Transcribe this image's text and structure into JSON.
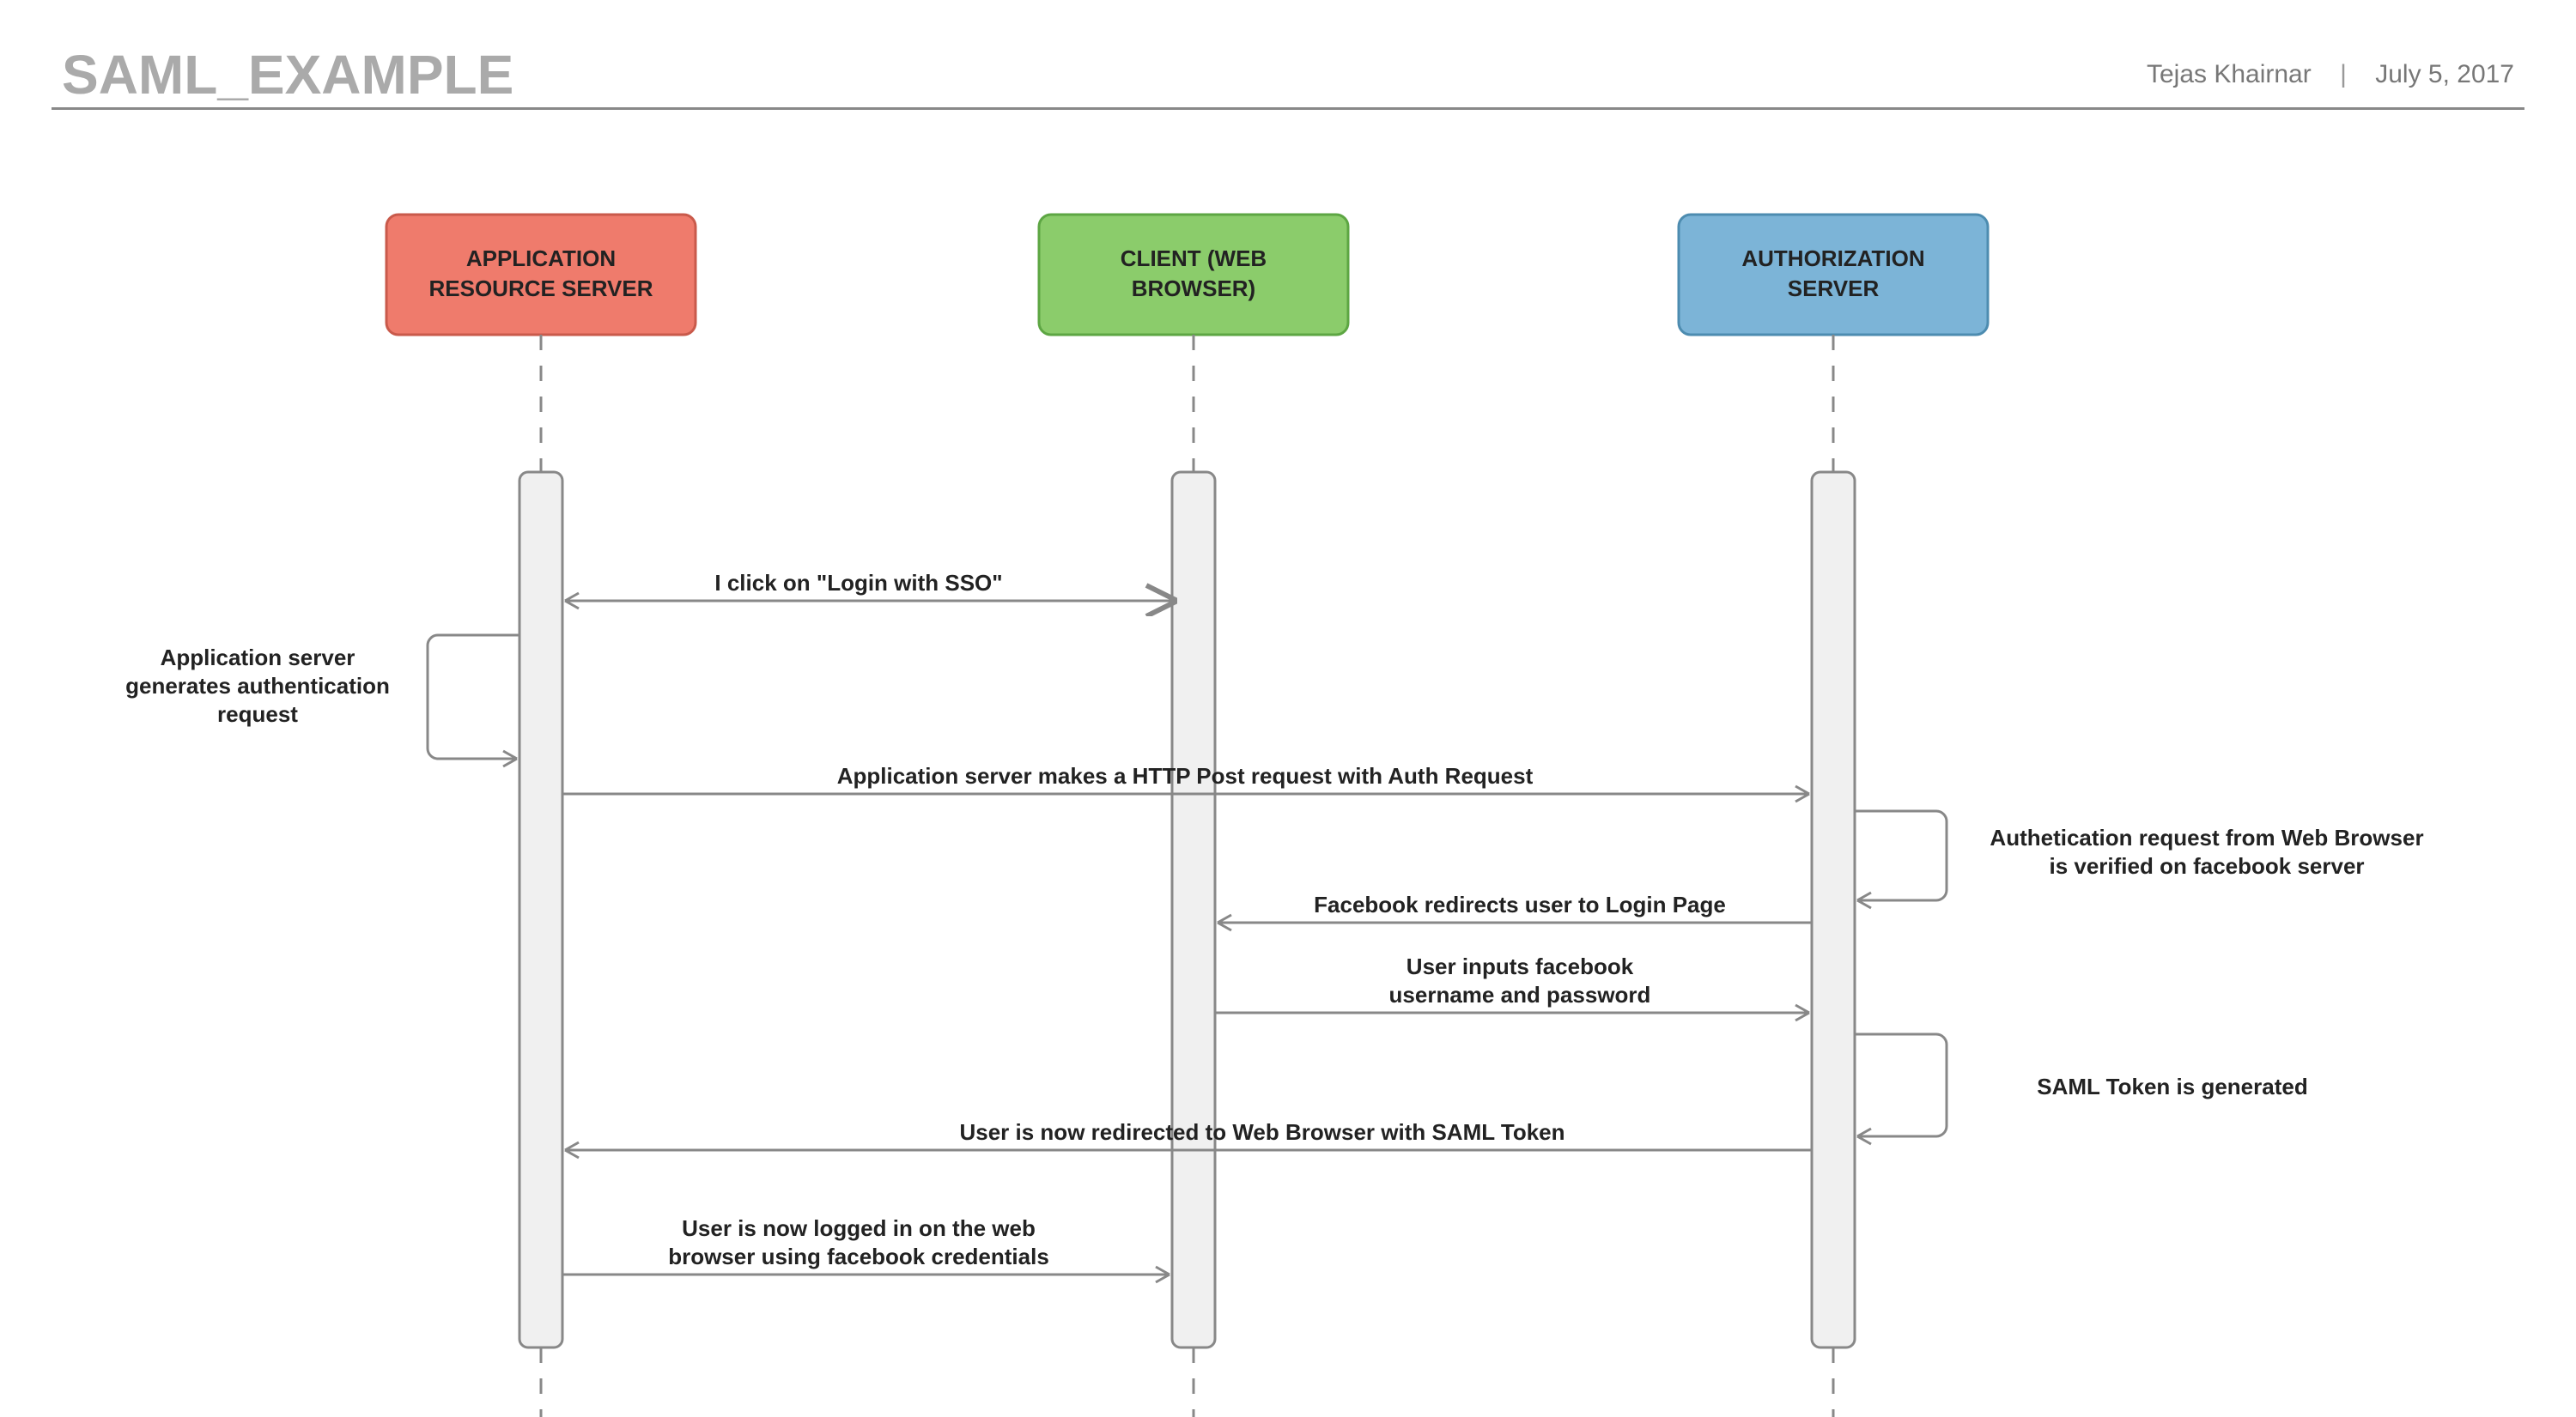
{
  "header": {
    "title": "SAML_EXAMPLE",
    "author": "Tejas Khairnar",
    "date": "July 5, 2017"
  },
  "lanes": {
    "app": {
      "label_line1": "APPLICATION",
      "label_line2": "RESOURCE SERVER",
      "fill": "#ef7b6c",
      "stroke": "#c95a4b"
    },
    "client": {
      "label_line1": "CLIENT (WEB",
      "label_line2": "BROWSER)",
      "fill": "#8bcc6b",
      "stroke": "#5da643"
    },
    "auth": {
      "label_line1": "AUTHORIZATION",
      "label_line2": "SERVER",
      "fill": "#7cb4d7",
      "stroke": "#4d8cb0"
    }
  },
  "messages": {
    "m1": "I click on \"Login with SSO\"",
    "self1_l1": "Application server",
    "self1_l2": "generates authentication",
    "self1_l3": "request",
    "m2": "Application server makes a HTTP Post request with Auth Request",
    "self2_l1": "Authetication request from Web Browser",
    "self2_l2": "is verified on facebook server",
    "m3": "Facebook redirects user to Login Page",
    "m4_l1": "User inputs facebook",
    "m4_l2": "username and password",
    "self3": "SAML Token is generated",
    "m5": "User is now redirected to Web Browser with SAML Token",
    "m6_l1": "User is now logged in on the web",
    "m6_l2": "browser using facebook credentials"
  }
}
